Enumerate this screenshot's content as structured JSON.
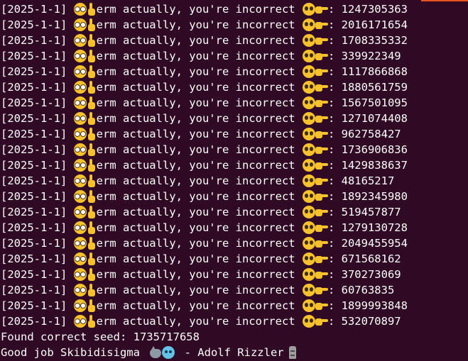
{
  "terminal": {
    "line_prefix": "[2025-1-1] ",
    "line_middle": "erm actually, you're incorrect ",
    "line_separator": ": ",
    "emoji_names": {
      "nerd": "nerd-face-icon",
      "finger": "index-pointing-up-icon",
      "plead": "pleading-face-icon",
      "point": "backhand-index-pointing-right-icon",
      "wolf": "wolf-icon",
      "cold": "cold-face-icon",
      "moai": "moai-icon"
    },
    "seeds": [
      "1247305363",
      "2016171654",
      "1708335332",
      "339922349",
      "1117866868",
      "1880561759",
      "1567501095",
      "1271074408",
      "962758427",
      "1736906836",
      "1429838637",
      "48165217",
      "1892345980",
      "519457877",
      "1279130728",
      "2049455954",
      "671568162",
      "370273069",
      "60763835",
      "1899993848",
      "532070897"
    ],
    "found_line": "Found correct seed: 1735717658",
    "final_text_before": "Good job Skibidisigma ",
    "final_text_after": " - Adolf Rizzler",
    "colors": {
      "background": "#300a24",
      "foreground": "#ffffff",
      "accent": "#e95420"
    }
  }
}
